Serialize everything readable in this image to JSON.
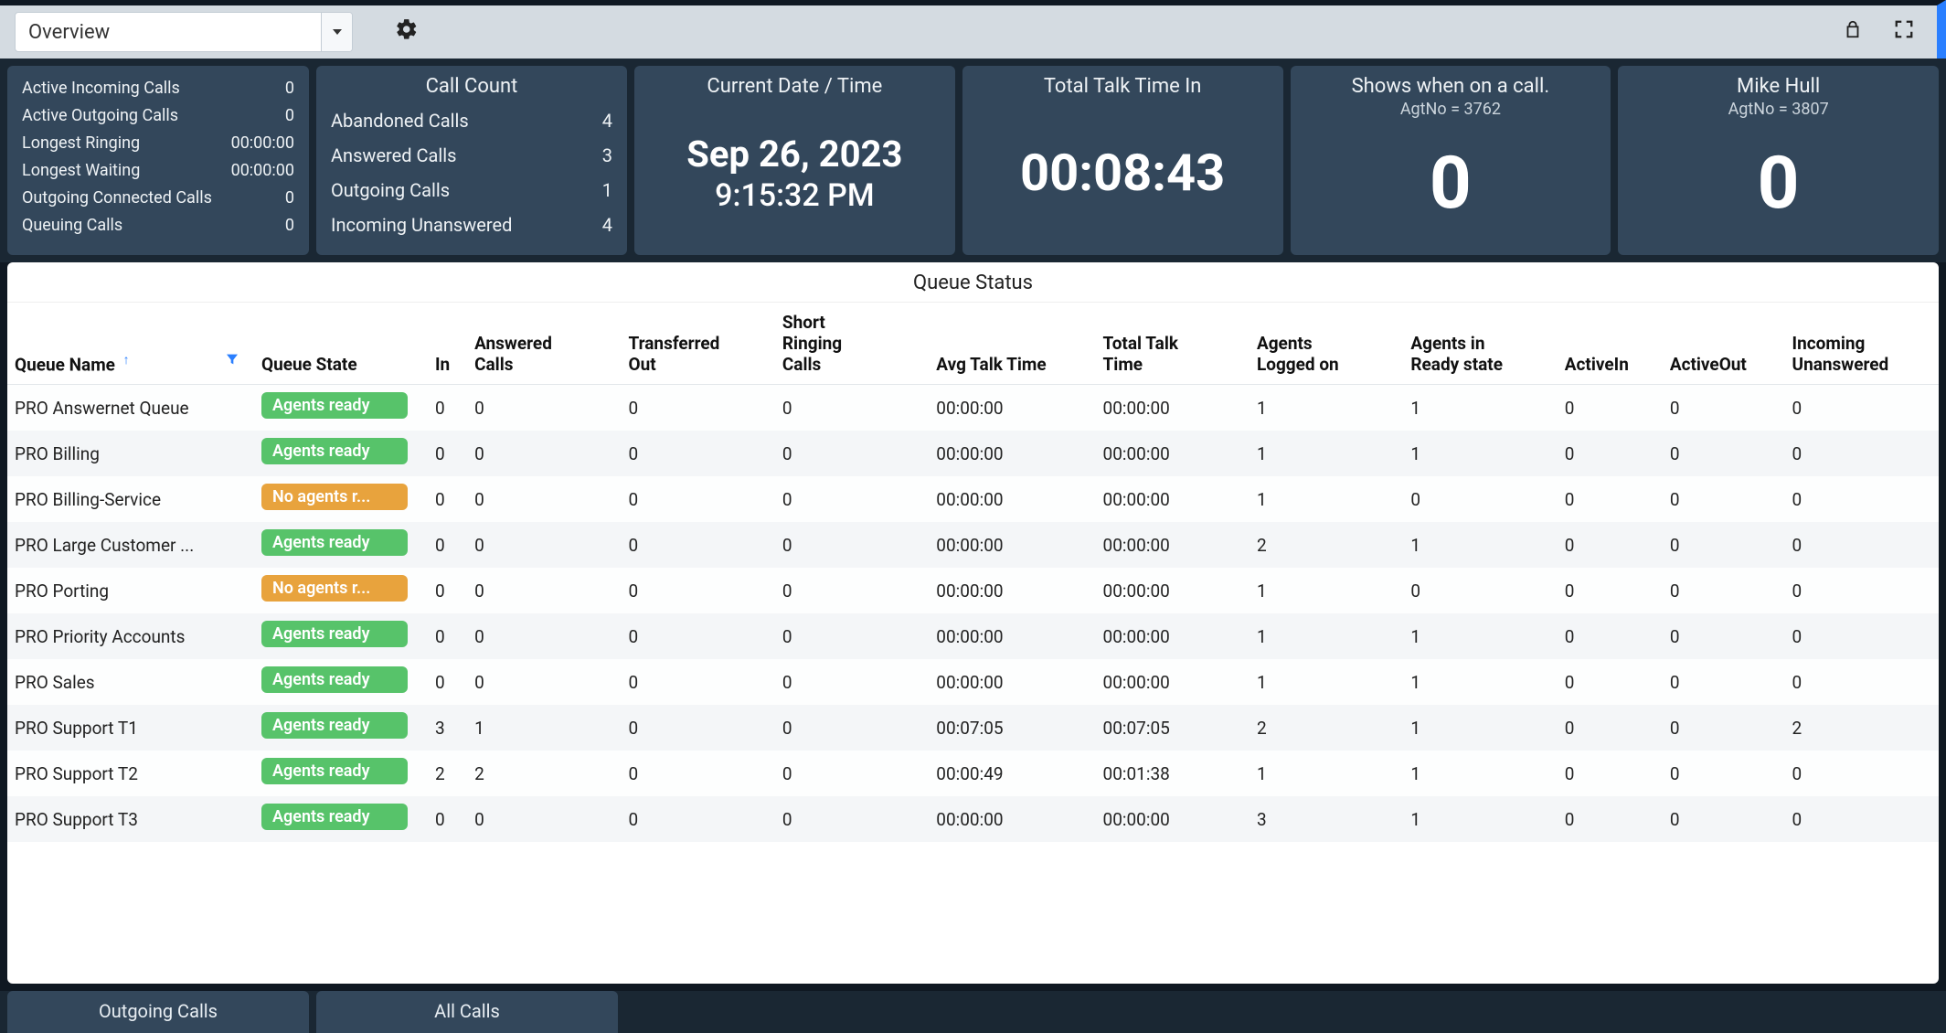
{
  "toolbar": {
    "view_label": "Overview"
  },
  "widgets": {
    "active": {
      "rows": [
        {
          "label": "Active Incoming Calls",
          "value": "0"
        },
        {
          "label": "Active Outgoing Calls",
          "value": "0"
        },
        {
          "label": "Longest Ringing",
          "value": "00:00:00"
        },
        {
          "label": "Longest Waiting",
          "value": "00:00:00"
        },
        {
          "label": "Outgoing Connected Calls",
          "value": "0"
        },
        {
          "label": "Queuing Calls",
          "value": "0"
        }
      ]
    },
    "call_count": {
      "title": "Call Count",
      "rows": [
        {
          "label": "Abandoned Calls",
          "value": "4"
        },
        {
          "label": "Answered Calls",
          "value": "3"
        },
        {
          "label": "Outgoing Calls",
          "value": "1"
        },
        {
          "label": "Incoming Unanswered",
          "value": "4"
        }
      ]
    },
    "datetime": {
      "title": "Current Date / Time",
      "date": "Sep 26, 2023",
      "time": "9:15:32 PM"
    },
    "talktime": {
      "title": "Total Talk Time In",
      "value": "00:08:43"
    },
    "agent1": {
      "title": "Shows when on a call.",
      "sub": "AgtNo = 3762",
      "value": "0"
    },
    "agent2": {
      "title": "Mike Hull",
      "sub": "AgtNo = 3807",
      "value": "0"
    }
  },
  "table": {
    "title": "Queue Status",
    "headers": {
      "queue_name": "Queue Name",
      "queue_state": "Queue State",
      "in": "In",
      "answered": "Answered Calls",
      "transferred": "Transferred Out",
      "short_ringing": "Short Ringing Calls",
      "avg_talk": "Avg Talk Time",
      "total_talk": "Total Talk Time",
      "agents_on": "Agents Logged on",
      "agents_ready": "Agents in Ready state",
      "active_in": "ActiveIn",
      "active_out": "ActiveOut",
      "incoming_unanswered": "Incoming Unanswered"
    },
    "state_labels": {
      "ready": "Agents ready",
      "noagents": "No agents r..."
    },
    "rows": [
      {
        "name": "PRO Answernet Queue",
        "state": "ready",
        "in": "0",
        "answered": "0",
        "transferred": "0",
        "short": "0",
        "avg": "00:00:00",
        "total": "00:00:00",
        "logged": "1",
        "readycnt": "1",
        "ain": "0",
        "aout": "0",
        "unans": "0"
      },
      {
        "name": "PRO Billing",
        "state": "ready",
        "in": "0",
        "answered": "0",
        "transferred": "0",
        "short": "0",
        "avg": "00:00:00",
        "total": "00:00:00",
        "logged": "1",
        "readycnt": "1",
        "ain": "0",
        "aout": "0",
        "unans": "0"
      },
      {
        "name": "PRO Billing-Service",
        "state": "noagents",
        "in": "0",
        "answered": "0",
        "transferred": "0",
        "short": "0",
        "avg": "00:00:00",
        "total": "00:00:00",
        "logged": "1",
        "readycnt": "0",
        "ain": "0",
        "aout": "0",
        "unans": "0"
      },
      {
        "name": "PRO Large Customer ...",
        "state": "ready",
        "in": "0",
        "answered": "0",
        "transferred": "0",
        "short": "0",
        "avg": "00:00:00",
        "total": "00:00:00",
        "logged": "2",
        "readycnt": "1",
        "ain": "0",
        "aout": "0",
        "unans": "0"
      },
      {
        "name": "PRO Porting",
        "state": "noagents",
        "in": "0",
        "answered": "0",
        "transferred": "0",
        "short": "0",
        "avg": "00:00:00",
        "total": "00:00:00",
        "logged": "1",
        "readycnt": "0",
        "ain": "0",
        "aout": "0",
        "unans": "0"
      },
      {
        "name": "PRO Priority Accounts",
        "state": "ready",
        "in": "0",
        "answered": "0",
        "transferred": "0",
        "short": "0",
        "avg": "00:00:00",
        "total": "00:00:00",
        "logged": "1",
        "readycnt": "1",
        "ain": "0",
        "aout": "0",
        "unans": "0"
      },
      {
        "name": "PRO Sales",
        "state": "ready",
        "in": "0",
        "answered": "0",
        "transferred": "0",
        "short": "0",
        "avg": "00:00:00",
        "total": "00:00:00",
        "logged": "1",
        "readycnt": "1",
        "ain": "0",
        "aout": "0",
        "unans": "0"
      },
      {
        "name": "PRO Support T1",
        "state": "ready",
        "in": "3",
        "answered": "1",
        "transferred": "0",
        "short": "0",
        "avg": "00:07:05",
        "total": "00:07:05",
        "logged": "2",
        "readycnt": "1",
        "ain": "0",
        "aout": "0",
        "unans": "2"
      },
      {
        "name": "PRO Support T2",
        "state": "ready",
        "in": "2",
        "answered": "2",
        "transferred": "0",
        "short": "0",
        "avg": "00:00:49",
        "total": "00:01:38",
        "logged": "1",
        "readycnt": "1",
        "ain": "0",
        "aout": "0",
        "unans": "0"
      },
      {
        "name": "PRO Support T3",
        "state": "ready",
        "in": "0",
        "answered": "0",
        "transferred": "0",
        "short": "0",
        "avg": "00:00:00",
        "total": "00:00:00",
        "logged": "3",
        "readycnt": "1",
        "ain": "0",
        "aout": "0",
        "unans": "0"
      }
    ]
  },
  "tabs": {
    "outgoing": "Outgoing Calls",
    "all": "All Calls"
  }
}
